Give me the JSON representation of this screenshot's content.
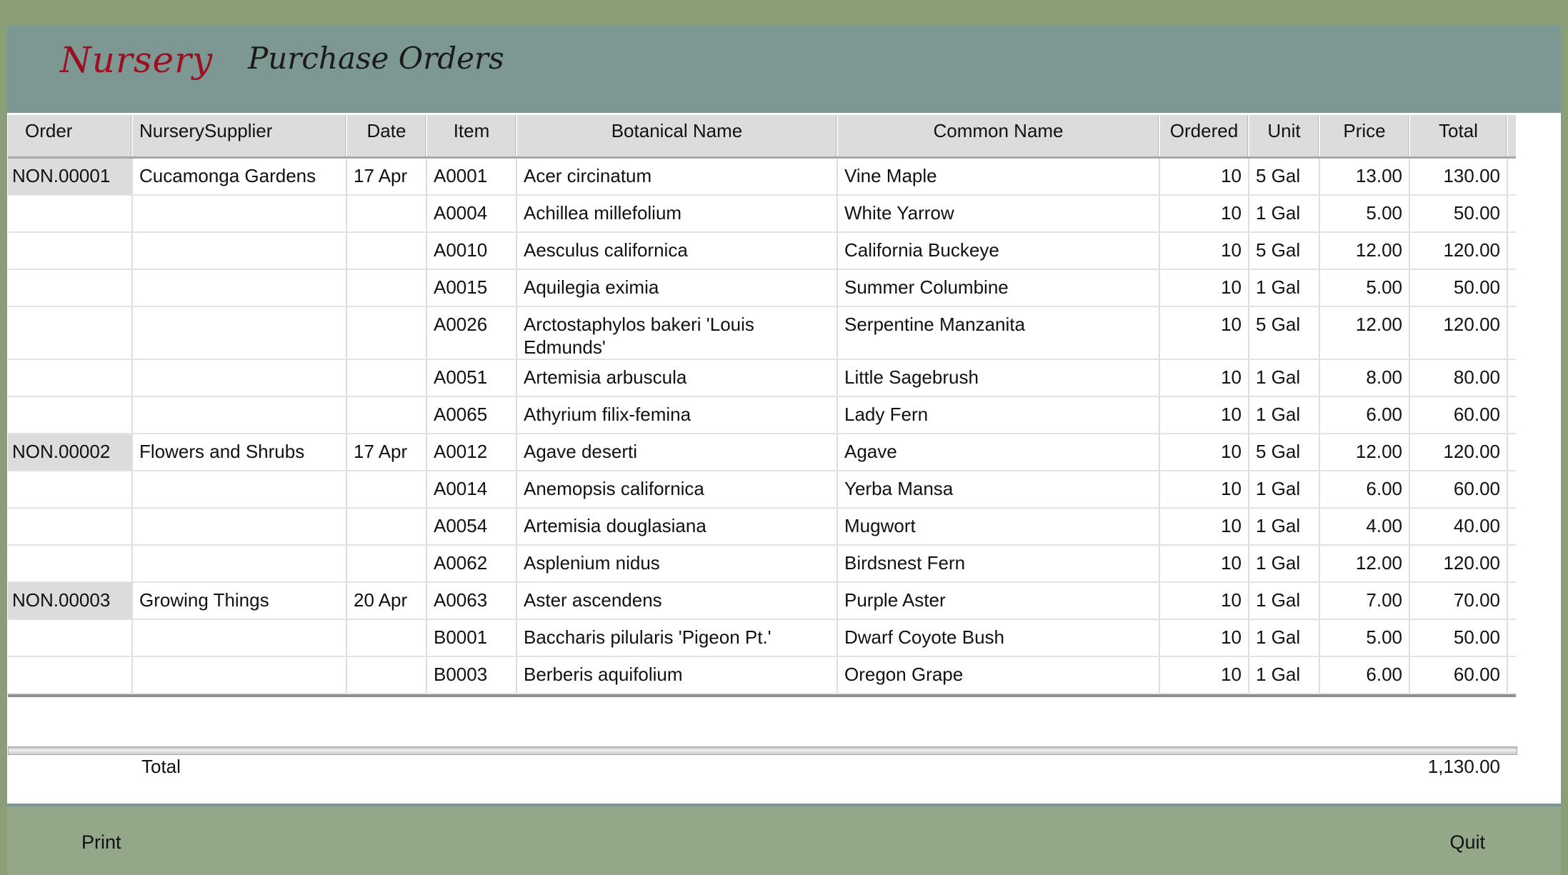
{
  "header": {
    "app_title": "Nursery",
    "page_title": "Purchase Orders"
  },
  "columns": [
    "Order",
    "NurserySupplier",
    "Date",
    "Item",
    "Botanical Name",
    "Common Name",
    "Ordered",
    "Unit",
    "Price",
    "Total"
  ],
  "sort": {
    "column": "Order",
    "direction": "ascending",
    "icon": "sort-ascending-icon"
  },
  "rows": [
    [
      "NON.00001",
      "Cucamonga Gardens",
      "17 Apr",
      "A0001",
      "Acer circinatum",
      "Vine Maple",
      "10",
      "5 Gal",
      "13.00",
      "130.00"
    ],
    [
      "",
      "",
      "",
      "A0004",
      "Achillea millefolium",
      "White Yarrow",
      "10",
      "1 Gal",
      "5.00",
      "50.00"
    ],
    [
      "",
      "",
      "",
      "A0010",
      "Aesculus californica",
      "California Buckeye",
      "10",
      "5 Gal",
      "12.00",
      "120.00"
    ],
    [
      "",
      "",
      "",
      "A0015",
      "Aquilegia eximia",
      "Summer Columbine",
      "10",
      "1 Gal",
      "5.00",
      "50.00"
    ],
    [
      "",
      "",
      "",
      "A0026",
      "Arctostaphylos bakeri 'Louis Edmunds'",
      "Serpentine Manzanita",
      "10",
      "5 Gal",
      "12.00",
      "120.00"
    ],
    [
      "",
      "",
      "",
      "A0051",
      "Artemisia arbuscula",
      "Little Sagebrush",
      "10",
      "1 Gal",
      "8.00",
      "80.00"
    ],
    [
      "",
      "",
      "",
      "A0065",
      "Athyrium filix-femina",
      "Lady Fern",
      "10",
      "1 Gal",
      "6.00",
      "60.00"
    ],
    [
      "NON.00002",
      "Flowers and Shrubs",
      "17 Apr",
      "A0012",
      "Agave deserti",
      "Agave",
      "10",
      "5 Gal",
      "12.00",
      "120.00"
    ],
    [
      "",
      "",
      "",
      "A0014",
      "Anemopsis californica",
      "Yerba Mansa",
      "10",
      "1 Gal",
      "6.00",
      "60.00"
    ],
    [
      "",
      "",
      "",
      "A0054",
      "Artemisia douglasiana",
      "Mugwort",
      "10",
      "1 Gal",
      "4.00",
      "40.00"
    ],
    [
      "",
      "",
      "",
      "A0062",
      "Asplenium nidus",
      "Birdsnest Fern",
      "10",
      "1 Gal",
      "12.00",
      "120.00"
    ],
    [
      "NON.00003",
      "Growing Things",
      "20 Apr",
      "A0063",
      "Aster ascendens",
      "Purple Aster",
      "10",
      "1 Gal",
      "7.00",
      "70.00"
    ],
    [
      "",
      "",
      "",
      "B0001",
      "Baccharis pilularis 'Pigeon Pt.'",
      "Dwarf Coyote Bush",
      "10",
      "1 Gal",
      "5.00",
      "50.00"
    ],
    [
      "",
      "",
      "",
      "B0003",
      "Berberis aquifolium",
      "Oregon Grape",
      "10",
      "1 Gal",
      "6.00",
      "60.00"
    ]
  ],
  "summary": {
    "label": "Total",
    "value": "1,130.00"
  },
  "footer": {
    "print_label": "Print",
    "quit_label": "Quit"
  },
  "colors": {
    "background": "#8a9f78",
    "header": "#7d9892",
    "footer": "#93a888",
    "title": "#9b1020"
  }
}
